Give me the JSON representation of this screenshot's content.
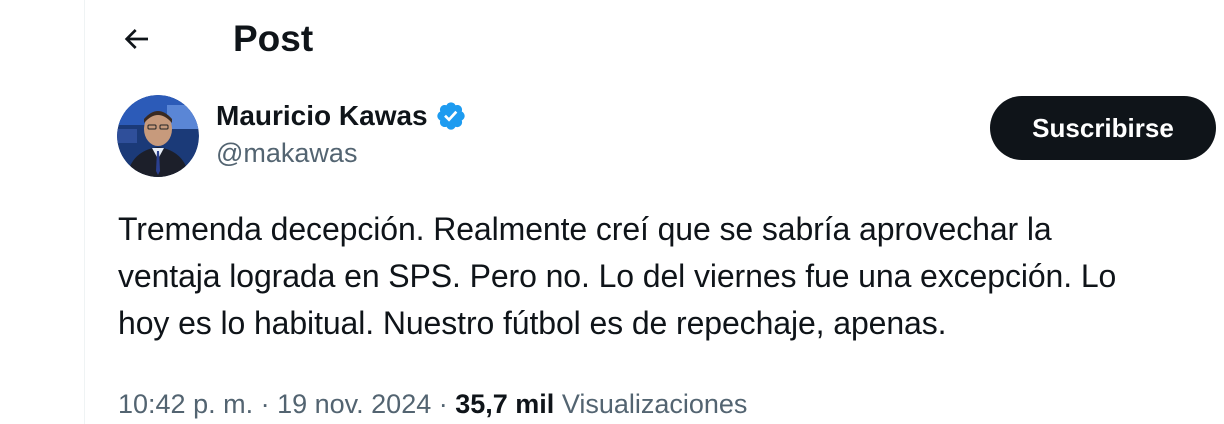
{
  "header": {
    "back_icon": "arrow-left-icon",
    "title": "Post"
  },
  "author": {
    "display_name": "Mauricio Kawas",
    "verified_icon": "verified-badge-icon",
    "handle": "@makawas",
    "avatar_icon": "avatar-photo"
  },
  "actions": {
    "subscribe_label": "Suscribirse"
  },
  "tweet": {
    "text": "Tremenda decepción. Realmente creí que se sabría aprovechar la\nventaja lograda en SPS.  Pero no. Lo del viernes fue una excepción. Lo\nhoy es lo habitual. Nuestro fútbol es de repechaje, apenas."
  },
  "meta": {
    "time": "10:42 p. m.",
    "separator": " · ",
    "date": "19 nov. 2024",
    "views_count": "35,7 mil",
    "views_label": "Visualizaciones"
  },
  "colors": {
    "text_primary": "#0f1419",
    "text_secondary": "#536471",
    "verified_blue": "#1d9bf0",
    "button_bg": "#0f1419"
  }
}
